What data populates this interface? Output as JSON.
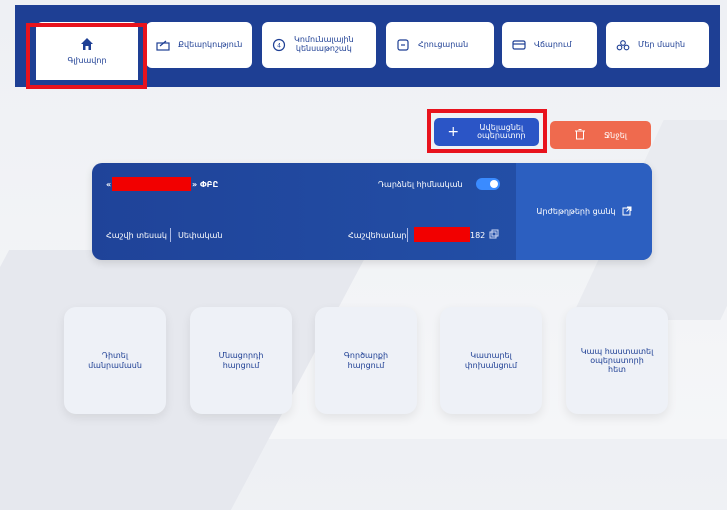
{
  "nav": {
    "tabs": [
      {
        "label": "Գլխավոր",
        "icon": "home-icon"
      },
      {
        "label": "Քվեարկություն",
        "icon": "ballot-icon"
      },
      {
        "label": "Կոմունալային\nկենսաթոշակ",
        "icon": "pension-icon"
      },
      {
        "label": "Հրուցարան",
        "icon": "archive-icon"
      },
      {
        "label": "Վճարում",
        "icon": "payment-card-icon"
      },
      {
        "label": "Մեր մասին",
        "icon": "about-icon"
      }
    ]
  },
  "actions": {
    "add_operator_label": "Ավելացնել\nօպերատոր",
    "delete_label": "Ջնջել"
  },
  "account_card": {
    "company_prefix": "«",
    "company_suffix": "» ՓԲԸ",
    "default_toggle_label": "Դարձնել հիմնական",
    "account_type_label": "Հաշվի տեսակ",
    "account_type_value": "Սեփական",
    "account_number_label": "Հաշվեհամար",
    "account_number_suffix": "182",
    "securities_list_label": "Արժեթղթերի ցանկ",
    "toggle_on": true
  },
  "tiles": [
    {
      "label": "Դիտել\nմանրամասն"
    },
    {
      "label": "Մնացորդի\nհարցում"
    },
    {
      "label": "Գործարքի\nհարցում"
    },
    {
      "label": "Կատարել\nփոխանցում"
    },
    {
      "label": "Կապ հաստատել\nօպերատորի\nհետ"
    }
  ]
}
